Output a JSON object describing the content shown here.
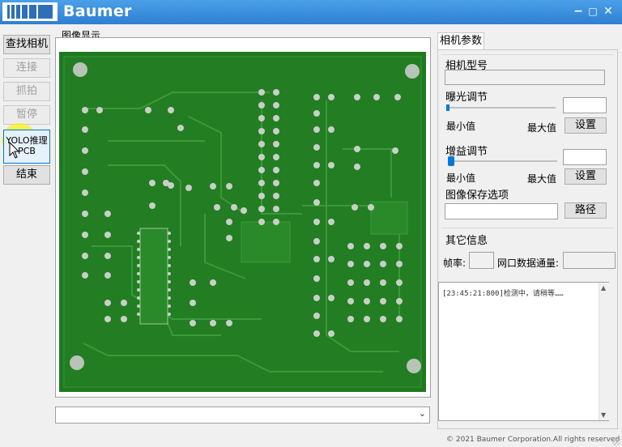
{
  "window": {
    "title": "Baumer",
    "minimize": "−",
    "maximize": "□",
    "close": "✕"
  },
  "left_buttons": {
    "find_camera": "查找相机",
    "connect": "连接",
    "capture": "抓拍",
    "pause": "暂停",
    "yolo_line1": "YOLO推理",
    "yolo_line2": "PCB",
    "end": "结束"
  },
  "image_display": {
    "label": "图像显示"
  },
  "tab": {
    "label": "相机参数"
  },
  "camera_model": {
    "title": "相机型号",
    "value": ""
  },
  "exposure": {
    "title": "曝光调节",
    "min_label": "最小值",
    "max_label": "最大值",
    "set_button": "设置",
    "value": "",
    "slider_fraction": 0
  },
  "gain": {
    "title": "增益调节",
    "min_label": "最小值",
    "max_label": "最大值",
    "set_button": "设置",
    "value": "",
    "slider_fraction": 0
  },
  "save": {
    "title": "图像保存选项",
    "path_value": "",
    "path_button": "路径"
  },
  "other": {
    "title": "其它信息",
    "fps_label": "帧率:",
    "fps_value": "",
    "net_label": "网口数据通量:",
    "net_value": ""
  },
  "log": {
    "line1": "[23:45:21:800]检测中，请稍等……"
  },
  "footer": {
    "copyright": "© 2021 Baumer Corporation.All rights reserved"
  },
  "colors": {
    "title_bar": "#2f7fd0",
    "pcb_green": "#1f7a1f",
    "accent": "#0078d7"
  }
}
